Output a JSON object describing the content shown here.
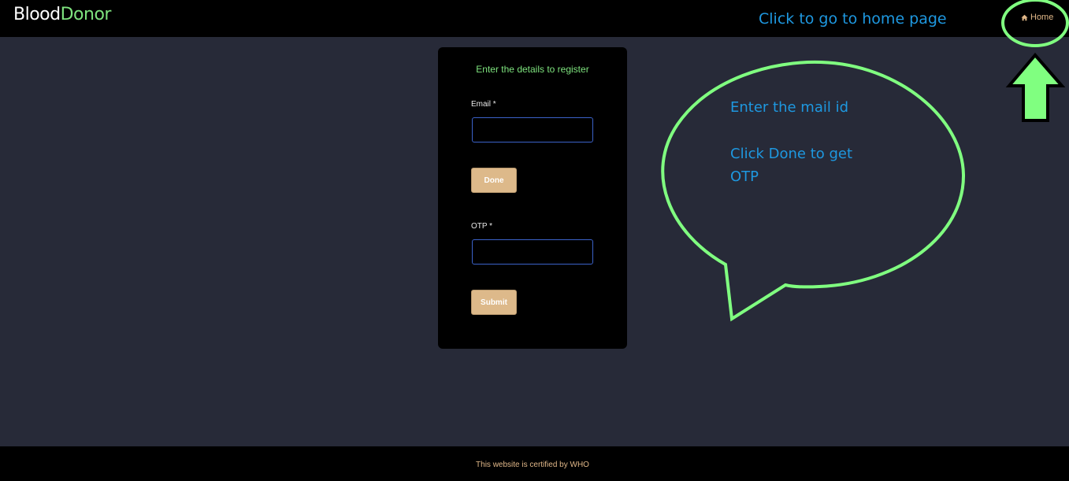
{
  "navbar": {
    "brand_part1": "Blood",
    "brand_part2": "Donor",
    "home_icon": "home-icon",
    "home_label": "Home"
  },
  "form": {
    "title": "Enter the details to register",
    "email_label": "Email *",
    "email_value": "",
    "done_label": "Done",
    "otp_label": "OTP *",
    "otp_value": "",
    "submit_label": "Submit"
  },
  "footer": {
    "text": "This website is certified by WHO"
  },
  "annotations": {
    "home_hint": "Click to go to home page",
    "mail_hint": "Enter the mail id",
    "done_hint": "Click Done to get OTP",
    "color": "#1e98e0",
    "highlight_color": "#80ff80"
  },
  "colors": {
    "background": "#272a38",
    "bar": "#000000",
    "brand_accent": "#7ee37e",
    "button": "#ddb98a",
    "link": "#e0b788",
    "input_border": "#3b62c9"
  }
}
